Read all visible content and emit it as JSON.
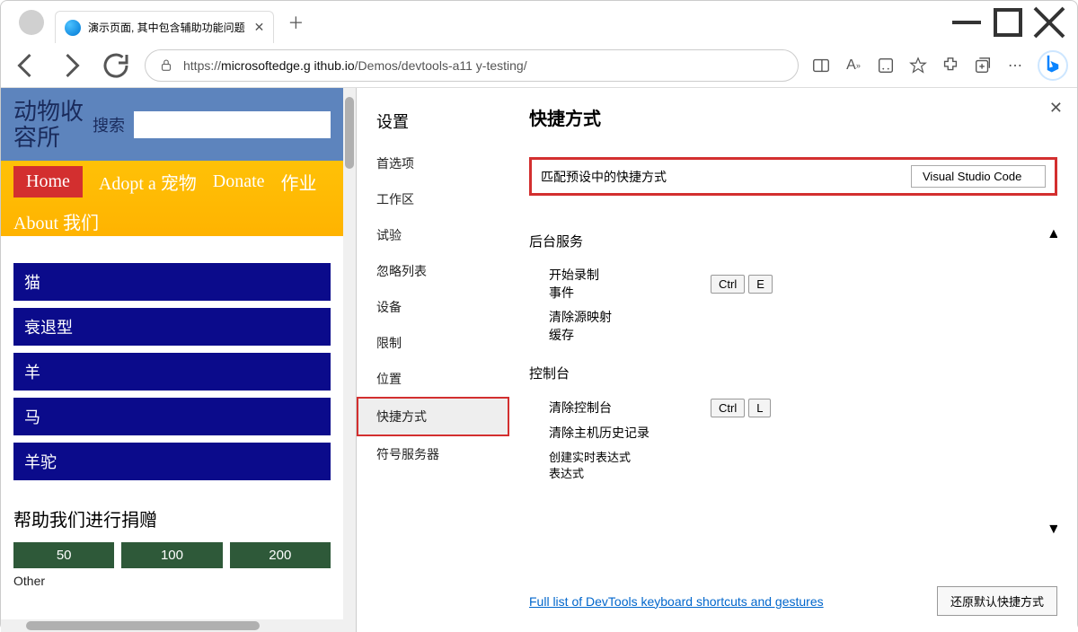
{
  "window": {
    "tab_title": "演示页面, 其中包含辅助功能问题"
  },
  "address": {
    "scheme": "https://",
    "host": "microsoftedge.g ithub.io",
    "path": "/Demos/devtools-a11 y-testing/"
  },
  "website": {
    "logo_line1": "动物收",
    "logo_line2": "容所",
    "search_label": "搜索",
    "nav": {
      "home": "Home",
      "adopt": "Adopt a 宠物",
      "donate": "Donate",
      "jobs": "作业",
      "about": "About 我们"
    },
    "categories": [
      "猫",
      "衰退型",
      "羊",
      "马",
      "羊驼"
    ],
    "donate_title": "帮助我们进行捐赠",
    "donate_amounts": [
      "50",
      "100",
      "200"
    ],
    "other": "Other"
  },
  "settings": {
    "title": "设置",
    "items": [
      "首选项",
      "工作区",
      "试验",
      "忽略列表",
      "设备",
      "限制",
      "位置",
      "快捷方式",
      "符号服务器"
    ],
    "active_index": 7
  },
  "shortcuts": {
    "heading": "快捷方式",
    "preset_label": "匹配预设中的快捷方式",
    "preset_value": "Visual Studio Code",
    "sections": [
      {
        "title": "后台服务",
        "actions": [
          {
            "label": "开始录制\n事件",
            "keys": [
              "Ctrl",
              "E"
            ]
          },
          {
            "label": "清除源映射\n缓存",
            "keys": []
          }
        ]
      },
      {
        "title": "控制台",
        "actions": [
          {
            "label": "清除控制台",
            "keys": [
              "Ctrl",
              "L"
            ]
          },
          {
            "label": "清除主机历史记录",
            "keys": []
          },
          {
            "label": "创建实时表达式\n    表达式",
            "keys": []
          }
        ]
      }
    ],
    "footer_link": "Full list of DevTools keyboard shortcuts and gestures",
    "restore_button": "还原默认快捷方式"
  }
}
